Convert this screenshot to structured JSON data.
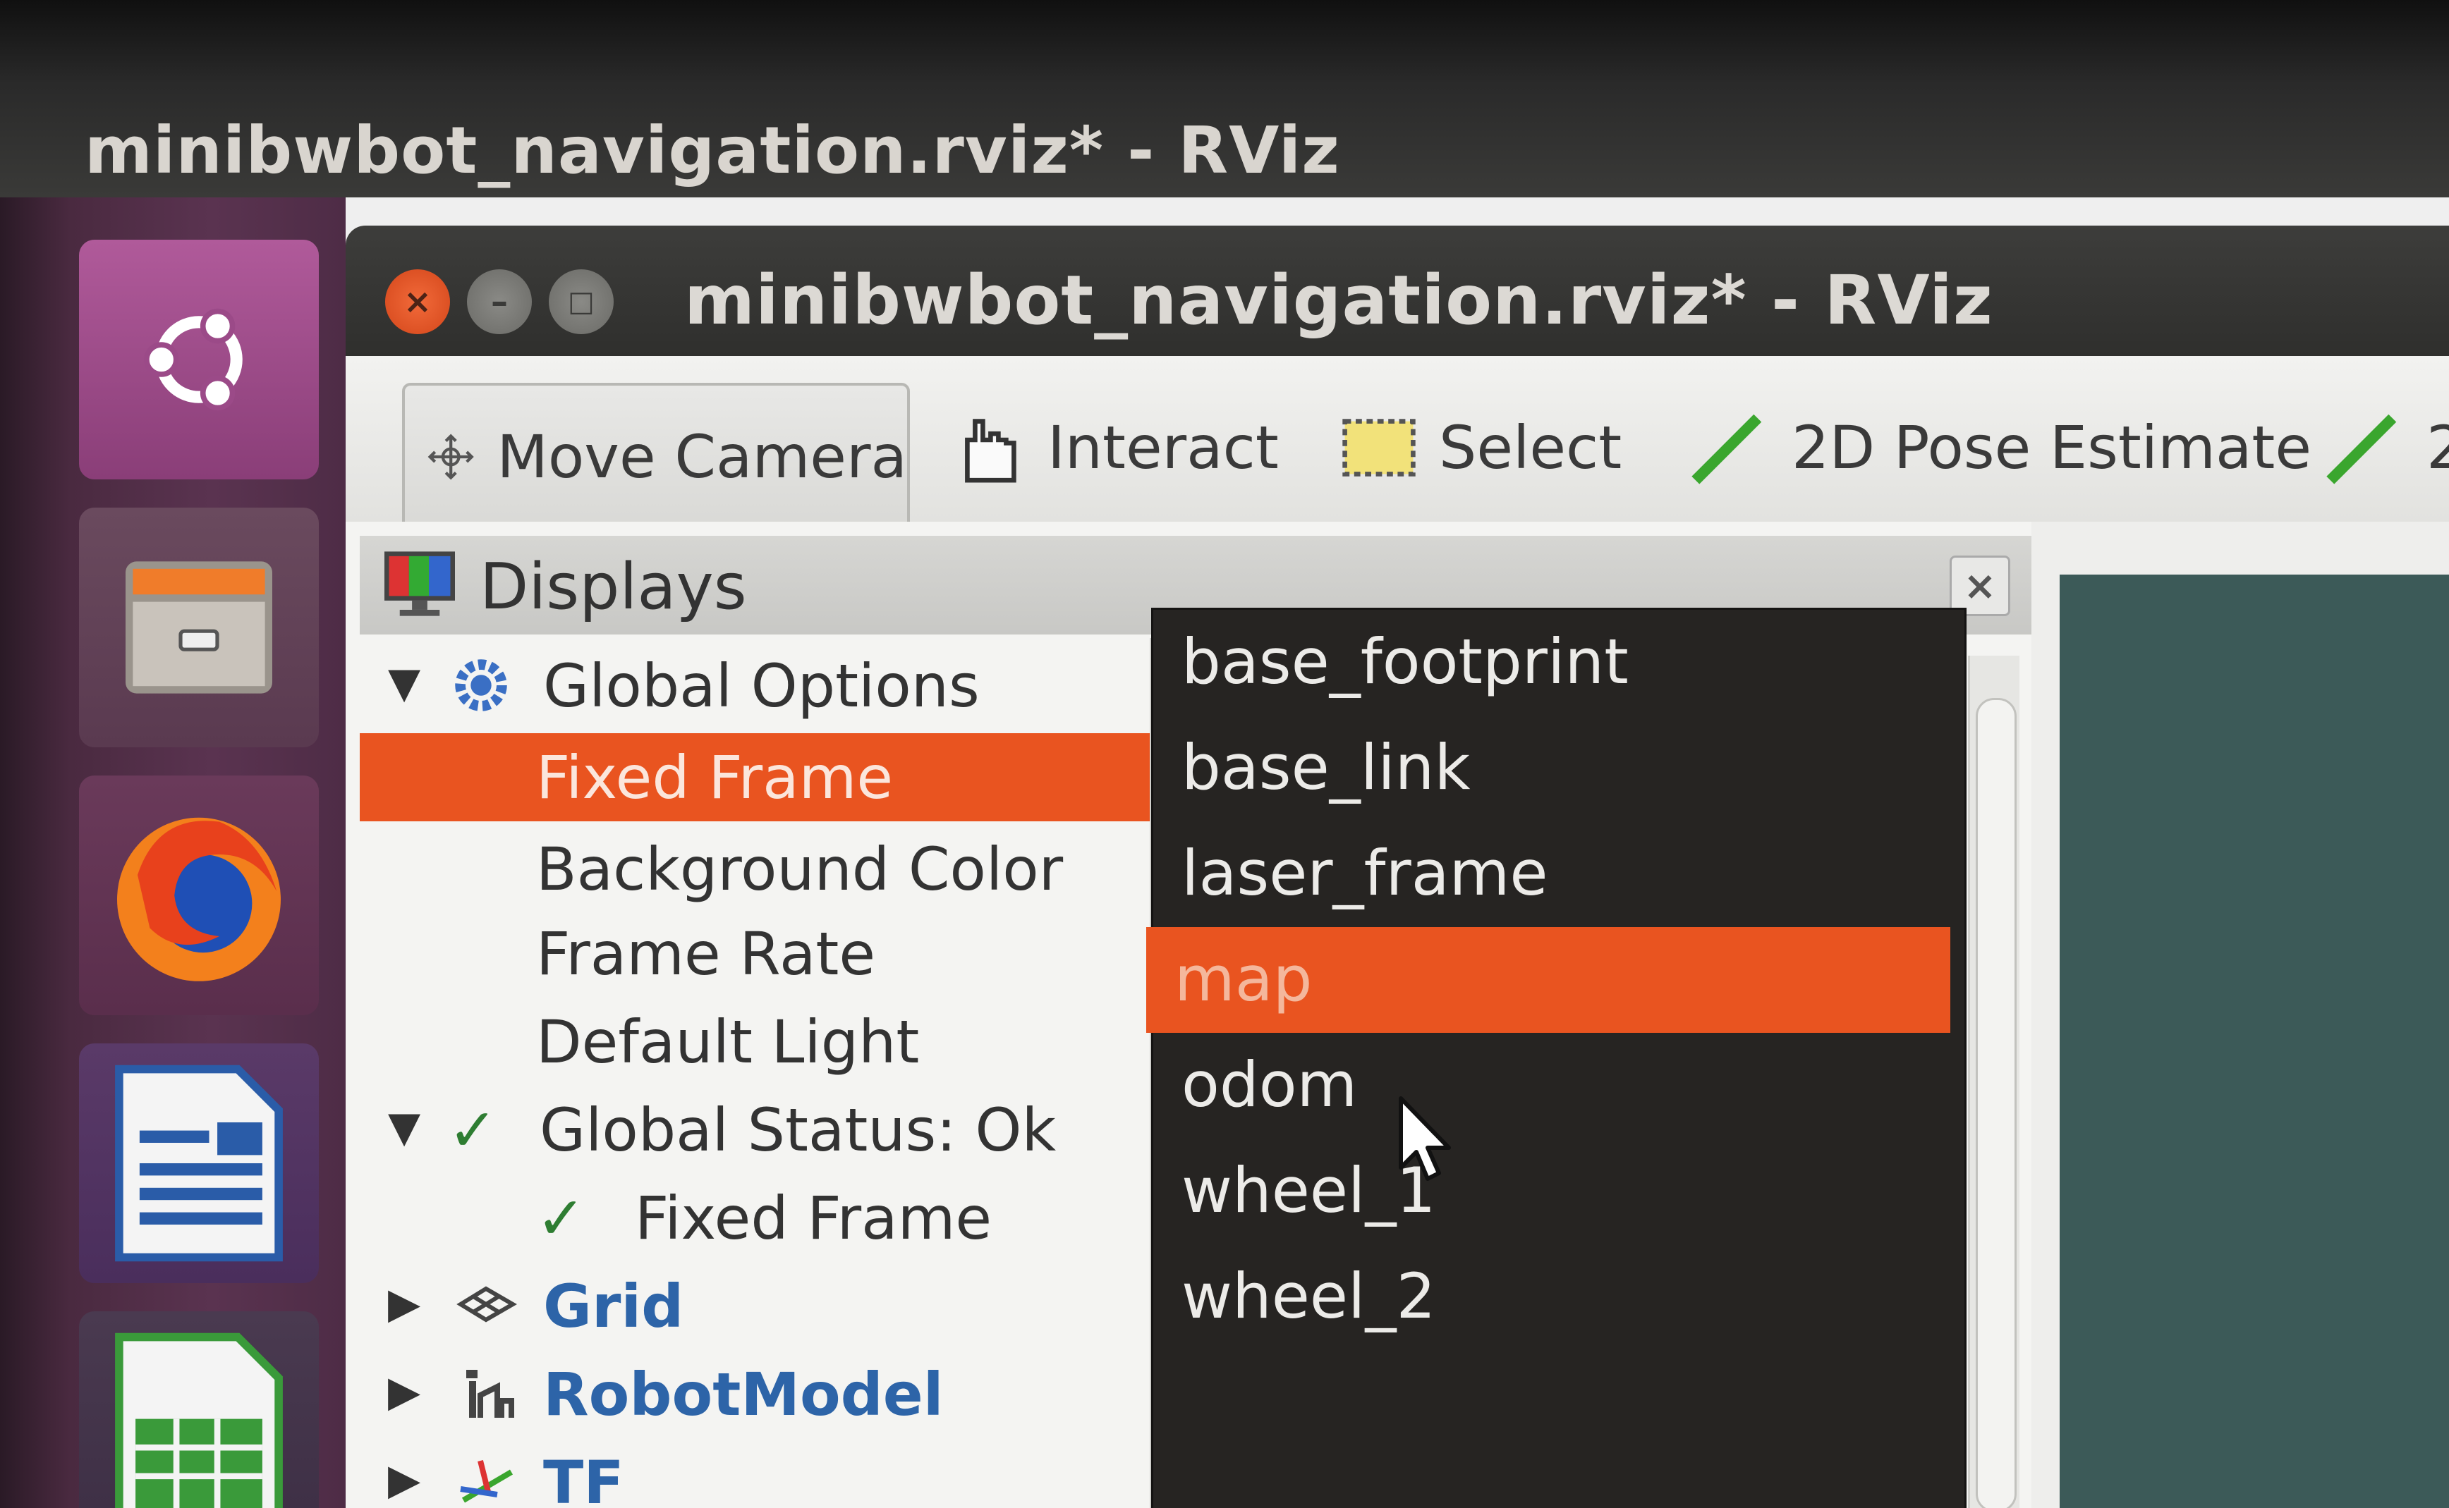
{
  "desktop": {
    "title": "minibwbot_navigation.rviz* - RViz"
  },
  "launcher": {
    "items": [
      "ubuntu-dash",
      "files",
      "firefox",
      "libreoffice-impress",
      "libreoffice-calc"
    ]
  },
  "window": {
    "title": "minibwbot_navigation.rviz* - RViz",
    "buttons": {
      "close": "×",
      "minimize": "–",
      "maximize": "□"
    }
  },
  "toolbar": {
    "tools": [
      {
        "label": "Move Camera",
        "icon": "move-camera-icon"
      },
      {
        "label": "Interact",
        "icon": "hand-icon"
      },
      {
        "label": "Select",
        "icon": "select-box-icon"
      },
      {
        "label": "2D Pose Estimate",
        "icon": "green-arrow-icon"
      },
      {
        "label": "2",
        "icon": "green-arrow-icon"
      }
    ]
  },
  "displays": {
    "title": "Displays",
    "close": "×",
    "tree": [
      {
        "label": "Global Options",
        "arrow": "▼"
      },
      {
        "label": "Fixed Frame",
        "selected": true
      },
      {
        "label": "Background Color"
      },
      {
        "label": "Frame Rate"
      },
      {
        "label": "Default Light"
      },
      {
        "label": "Global Status: Ok",
        "arrow": "▼",
        "check": "✓"
      },
      {
        "label": "Fixed Frame",
        "check": "✓"
      },
      {
        "label": "Grid",
        "arrow": "▶"
      },
      {
        "label": "RobotModel",
        "arrow": "▶"
      },
      {
        "label": "TF",
        "arrow": "▶"
      }
    ]
  },
  "frame_dropdown": {
    "options": [
      "base_footprint",
      "base_link",
      "laser_frame",
      "map",
      "odom",
      "wheel_1",
      "wheel_2"
    ],
    "highlighted": "map"
  },
  "colors": {
    "accent": "#e95420",
    "link": "#2d64a8",
    "dropdown_bg": "#262422",
    "check": "#2e7d32"
  }
}
